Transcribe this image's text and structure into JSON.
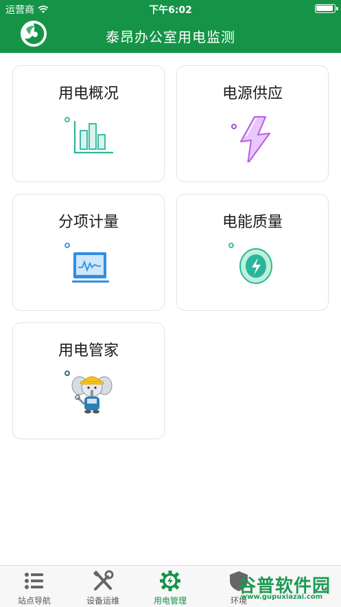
{
  "status_bar": {
    "carrier": "运营商",
    "time": "下午6:02"
  },
  "header": {
    "title": "泰昂办公室用电监测"
  },
  "cards": [
    {
      "label": "用电概况",
      "icon": "bar-chart-icon"
    },
    {
      "label": "电源供应",
      "icon": "lightning-icon"
    },
    {
      "label": "分项计量",
      "icon": "laptop-monitor-icon"
    },
    {
      "label": "电能质量",
      "icon": "energy-badge-icon"
    },
    {
      "label": "用电管家",
      "icon": "elephant-mascot-icon"
    }
  ],
  "tabs": [
    {
      "label": "站点导航",
      "icon": "list-icon",
      "active": false
    },
    {
      "label": "设备运维",
      "icon": "tools-icon",
      "active": false
    },
    {
      "label": "用电管理",
      "icon": "gear-lightning-icon",
      "active": true
    },
    {
      "label": "环境",
      "icon": "shield-icon",
      "active": false
    }
  ],
  "watermark": {
    "text": "谷普软件园",
    "url": "www.gupuxiazai.com"
  },
  "colors": {
    "brand_green": "#159447",
    "teal": "#2bb59a",
    "purple": "#c27de8",
    "blue": "#2f8de4"
  }
}
